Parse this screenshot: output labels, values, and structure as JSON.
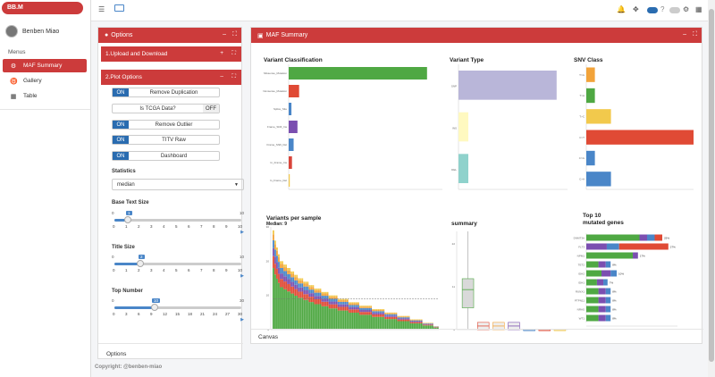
{
  "app": {
    "logo": "BB.M"
  },
  "user": {
    "name": "Benben Miao"
  },
  "sidebar": {
    "menus_label": "Menus",
    "items": [
      {
        "label": "MAF Summary",
        "icon": "gear-icon",
        "active": true
      },
      {
        "label": "Gallery",
        "icon": "gallery-icon",
        "active": false
      },
      {
        "label": "Table",
        "icon": "table-icon",
        "active": false
      }
    ]
  },
  "options_panel": {
    "title": "Options",
    "upload_section": "1.Upload and Download",
    "plot_section": "2.Plot Options",
    "toggles": [
      {
        "state": "ON",
        "label": "Remove Duplication"
      },
      {
        "state": "OFF",
        "label": "Is TCGA Data?"
      },
      {
        "state": "ON",
        "label": "Remove Outlier"
      },
      {
        "state": "ON",
        "label": "TITV Raw"
      },
      {
        "state": "ON",
        "label": "Dashboard"
      }
    ],
    "statistics_label": "Statistics",
    "statistics_value": "median",
    "sliders": [
      {
        "label": "Base Text Size",
        "min": "0",
        "max": "10",
        "value": "1",
        "ticks": [
          "0",
          "1",
          "2",
          "3",
          "4",
          "5",
          "6",
          "7",
          "8",
          "9",
          "10"
        ]
      },
      {
        "label": "Title Size",
        "min": "0",
        "max": "10",
        "value": "2",
        "ticks": [
          "0",
          "1",
          "2",
          "3",
          "4",
          "5",
          "6",
          "7",
          "8",
          "9",
          "10"
        ]
      },
      {
        "label": "Top Number",
        "min": "0",
        "max": "30",
        "value": "10",
        "ticks": [
          "0",
          "3",
          "6",
          "9",
          "12",
          "15",
          "18",
          "21",
          "24",
          "27",
          "30"
        ]
      }
    ],
    "footer_label": "Options"
  },
  "maf_panel": {
    "title": "MAF Summary",
    "canvas_label": "Canvas"
  },
  "footer": {
    "copyright": "Copyright: @benben-miao"
  },
  "chart_data": [
    {
      "type": "bar",
      "title": "Variant Classification",
      "categories": [
        "Missense_Mutation",
        "Nonsense_Mutation",
        "Splice_Site",
        "Frame_Shift_Ins",
        "Frame_Shift_Del",
        "In_Frame_Ins",
        "In_Frame_Del"
      ],
      "values": [
        1260,
        95,
        25,
        80,
        45,
        30,
        10
      ],
      "colors": [
        "#4fa843",
        "#e04a35",
        "#4a86c8",
        "#7b4fb0",
        "#4a86c8",
        "#d9453a",
        "#f2c94c"
      ],
      "xlim": [
        0,
        1400
      ]
    },
    {
      "type": "bar",
      "title": "Variant Type",
      "categories": [
        "SNP",
        "INS",
        "DEL"
      ],
      "values": [
        1800,
        180,
        180
      ],
      "colors": [
        "#b9b6d9",
        "#fff9c0",
        "#8fd2cc"
      ],
      "xlim": [
        0,
        2000
      ]
    },
    {
      "type": "bar",
      "title": "SNV Class",
      "categories": [
        "T>G",
        "T>A",
        "T>C",
        "C>T",
        "C>G",
        "C>A"
      ],
      "values": [
        80,
        80,
        230,
        1000,
        80,
        230
      ],
      "colors": [
        "#f2a33a",
        "#4fa843",
        "#f2c94c",
        "#e04a35",
        "#4a86c8",
        "#4a86c8"
      ],
      "xlim": [
        0,
        1000
      ]
    },
    {
      "type": "bar",
      "title": "Variants per sample",
      "subtitle": "Median: 9",
      "yticks": [
        "0",
        "10",
        "20",
        "30"
      ],
      "median": 9,
      "series": [
        {
          "values": [
            29,
            26,
            24,
            22,
            20,
            20,
            19,
            19,
            18,
            18,
            17,
            17,
            16,
            16,
            15,
            15,
            15,
            14,
            14,
            14,
            13,
            13,
            13,
            12,
            12,
            12,
            12,
            11,
            11,
            11,
            11,
            10,
            10,
            10,
            10,
            10,
            9,
            9,
            9,
            9,
            9,
            9,
            8,
            8,
            8,
            8,
            8,
            8,
            7,
            7,
            7,
            7,
            7,
            7,
            7,
            6,
            6,
            6,
            6,
            6,
            6,
            6,
            5,
            5,
            5,
            5,
            5,
            5,
            5,
            4,
            4,
            4,
            4,
            4,
            4,
            4,
            3,
            3,
            3,
            3,
            3,
            3,
            3,
            2,
            2,
            2,
            2,
            2,
            2,
            1,
            1,
            1
          ]
        }
      ]
    },
    {
      "type": "box",
      "title": "summary",
      "yticks": [
        "0",
        "11",
        "22"
      ],
      "boxes": [
        {
          "color": "#4fa843",
          "q1": 6,
          "median": 11,
          "q3": 14,
          "min": 0,
          "max": 27
        },
        {
          "color": "#e04a35",
          "q1": 0,
          "median": 1,
          "q3": 2
        },
        {
          "color": "#f2a33a",
          "q1": 0,
          "median": 1,
          "q3": 2
        },
        {
          "color": "#7b4fb0",
          "q1": 0,
          "median": 1,
          "q3": 2
        },
        {
          "color": "#4a86c8",
          "q1": 0,
          "median": 0,
          "q3": 0
        },
        {
          "color": "#e04a35",
          "q1": 0,
          "median": 0,
          "q3": 0
        },
        {
          "color": "#f2c94c",
          "q1": 0,
          "median": 0,
          "q3": 0
        }
      ]
    },
    {
      "type": "bar",
      "title": "Top 10\nmutated genes",
      "categories": [
        "DNMT3A",
        "FLT3",
        "NPM1",
        "TET2",
        "IDH2",
        "IDH1",
        "RUNX1",
        "PTPN11",
        "NRAS",
        "WT1"
      ],
      "values": [
        25,
        27,
        17,
        8,
        10,
        7,
        8,
        8,
        8,
        8
      ],
      "labels": [
        "25%",
        "27%",
        "17%",
        "8%",
        "10%",
        "7%",
        "8%",
        "8%",
        "8%",
        "8%"
      ],
      "xlim": [
        0,
        30
      ]
    }
  ]
}
